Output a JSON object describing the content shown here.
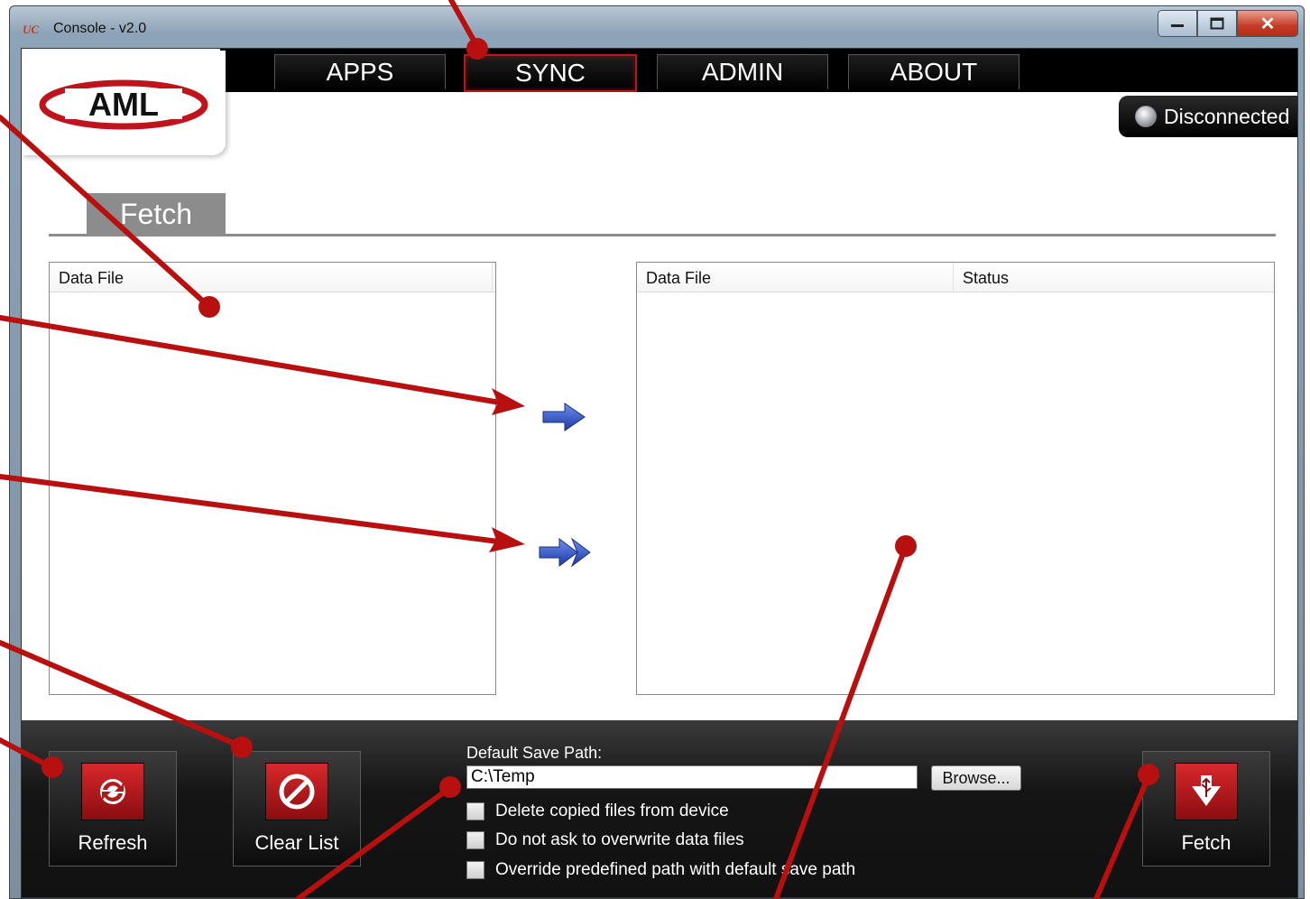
{
  "window": {
    "title": "Console - v2.0",
    "app_icon_text": "UC"
  },
  "nav": {
    "tabs": [
      {
        "label": "APPS",
        "active": false
      },
      {
        "label": "SYNC",
        "active": true
      },
      {
        "label": "ADMIN",
        "active": false
      },
      {
        "label": "ABOUT",
        "active": false
      }
    ]
  },
  "logo_text": "AML",
  "connection": {
    "status": "Disconnected"
  },
  "section": {
    "title": "Fetch"
  },
  "left_list": {
    "columns": [
      "Data File"
    ],
    "rows": []
  },
  "right_list": {
    "columns": [
      "Data File",
      "Status"
    ],
    "rows": []
  },
  "bottom": {
    "refresh_label": "Refresh",
    "clear_label": "Clear List",
    "fetch_label": "Fetch",
    "save_path_label": "Default Save Path:",
    "save_path_value": "C:\\Temp",
    "browse_label": "Browse...",
    "options": [
      {
        "label": "Delete copied files from device",
        "checked": false
      },
      {
        "label": "Do not ask to overwrite data files",
        "checked": false
      },
      {
        "label": "Override predefined path with default save path",
        "checked": false
      }
    ]
  },
  "colors": {
    "accent": "#c0141c",
    "arrow": "#2b4fbf",
    "annotation": "#b80f0f"
  }
}
